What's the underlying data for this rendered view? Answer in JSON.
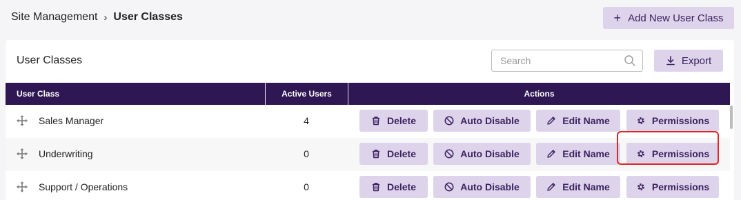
{
  "breadcrumb": {
    "parent": "Site Management",
    "separator": "›",
    "current": "User Classes"
  },
  "header": {
    "add_button_label": "Add New User Class",
    "add_icon": "plus-icon"
  },
  "card": {
    "title": "User Classes",
    "search_placeholder": "Search",
    "search_value": "",
    "export_label": "Export"
  },
  "table": {
    "columns": [
      "User Class",
      "Active Users",
      "Actions"
    ],
    "rows": [
      {
        "name": "Sales Manager",
        "active_users": "4"
      },
      {
        "name": "Underwriting",
        "active_users": "0"
      },
      {
        "name": "Support / Operations",
        "active_users": "0"
      }
    ],
    "actions": {
      "delete": "Delete",
      "auto_disable": "Auto Disable",
      "edit_name": "Edit Name",
      "permissions": "Permissions"
    },
    "highlighted": {
      "row": "Underwriting",
      "action": "Permissions"
    }
  },
  "colors": {
    "accent_dark": "#2e1752",
    "button_bg": "#ddd3ea",
    "button_text": "#3b2160",
    "highlight": "#e02626"
  }
}
